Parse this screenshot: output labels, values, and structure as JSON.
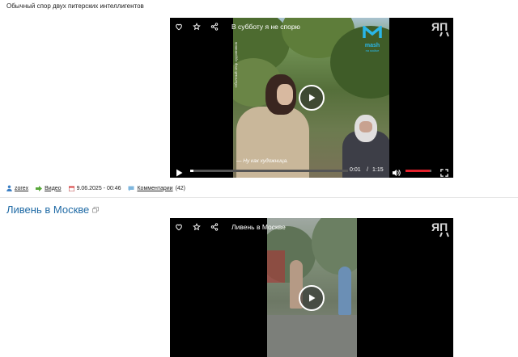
{
  "post1": {
    "caption": "Обычный спор двух питерских интеллигентов",
    "video": {
      "title": "В субботу я не спорю",
      "subtitle": "— Ну как художница.",
      "time_current": "0:01",
      "time_sep": "/",
      "time_total": "1:15",
      "progress": 0.02,
      "volume": 0.95,
      "watermark": "mash",
      "watermark_sub": "на мойке",
      "side_text": "Обычный спор художников"
    },
    "meta": {
      "author": "zorex",
      "category": "Видео",
      "date": "9.06.2025 - 00:46",
      "comments_label": "Комментарии",
      "comments_count": "(42)"
    }
  },
  "post2": {
    "heading": "Ливень в Москве",
    "video": {
      "title": "Ливень в Москве"
    }
  },
  "logo_text": "ЯП",
  "colors": {
    "accent": "#1f6aa5",
    "volume": "#e3212c"
  },
  "icons": [
    "heart-icon",
    "star-icon",
    "share-icon",
    "play-icon",
    "volume-icon",
    "fullscreen-icon",
    "user-icon",
    "arrow-icon",
    "calendar-icon",
    "comment-icon",
    "external-link-icon"
  ]
}
